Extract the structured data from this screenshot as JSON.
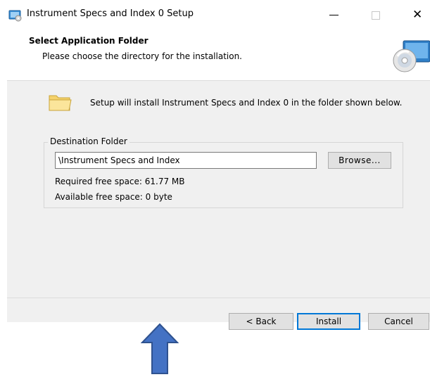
{
  "window": {
    "title": "Instrument Specs and Index 0 Setup",
    "controls": {
      "minimize": "—",
      "close": "✕"
    }
  },
  "header": {
    "title": "Select Application Folder",
    "subtitle": "Please choose the directory for the installation."
  },
  "body": {
    "intro": "Setup will install Instrument Specs and Index 0 in the folder shown below.",
    "group_label": "Destination Folder",
    "path_value": "\\Instrument Specs and Index",
    "browse_label": "Browse...",
    "required_space": "Required free space: 61.77 MB",
    "available_space": "Available free space: 0 byte"
  },
  "footer": {
    "back_label": "< Back",
    "install_label": "Install",
    "cancel_label": "Cancel"
  },
  "colors": {
    "accent": "#0078d7",
    "arrow_fill": "#4472c4",
    "arrow_stroke": "#2f528f",
    "folder": "#f5d26b"
  },
  "icons": [
    "setup-app-icon",
    "install-cd-icon",
    "folder-icon",
    "up-arrow-annotation"
  ]
}
